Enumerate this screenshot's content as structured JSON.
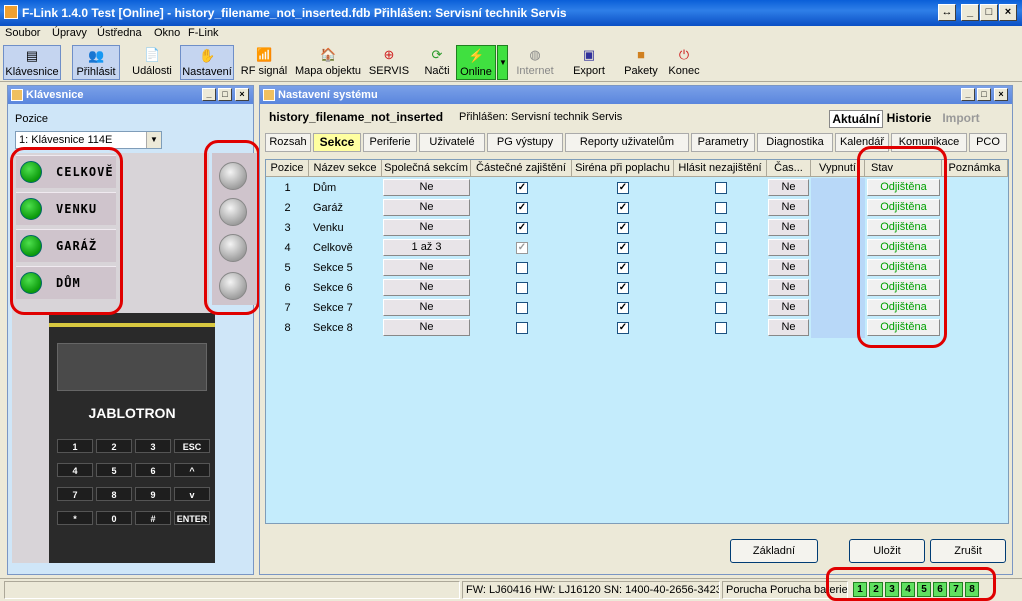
{
  "window": {
    "title": "F-Link 1.4.0 Test [Online] - history_filename_not_inserted.fdb Přihlášen: Servisní technik Servis"
  },
  "menu": [
    "Soubor",
    "Úpravy",
    "Ústředna",
    "Okno",
    "F-Link"
  ],
  "toolbar": [
    {
      "label": "Klávesnice",
      "icon": "keypad-icon"
    },
    {
      "label": "Přihlásit",
      "icon": "users-icon"
    },
    {
      "label": "Události",
      "icon": "document-icon"
    },
    {
      "label": "Nastavení",
      "icon": "hand-icon"
    },
    {
      "label": "RF signál",
      "icon": "antenna-icon"
    },
    {
      "label": "Mapa objektu",
      "icon": "house-icon"
    },
    {
      "label": "SERVIS",
      "icon": "servis-icon"
    },
    {
      "label": "Načti",
      "icon": "refresh-icon"
    },
    {
      "label": "Online",
      "icon": "online-icon"
    },
    {
      "label": "Internet",
      "icon": "globe-icon"
    },
    {
      "label": "Export",
      "icon": "floppy-icon"
    },
    {
      "label": "Pakety",
      "icon": "box-icon"
    },
    {
      "label": "Konec",
      "icon": "exit-icon"
    }
  ],
  "keypad_window": {
    "title": "Klávesnice",
    "position_label": "Pozice",
    "position_value": "1: Klávesnice 114E",
    "zones": [
      "CELKOVĚ",
      "VENKU",
      "GARÁŽ",
      "DŮM"
    ],
    "brand": "JABLOTRON",
    "keys": [
      "1",
      "2",
      "3",
      "ESC",
      "4",
      "5",
      "6",
      "^",
      "7",
      "8",
      "9",
      "v",
      "*",
      "0",
      "#",
      "ENTER"
    ]
  },
  "settings_window": {
    "title": "Nastavení systému",
    "db_name": "history_filename_not_inserted",
    "logged_in": "Přihlášen: Servisní technik Servis",
    "view_current": "Aktuální",
    "view_history": "Historie",
    "view_import": "Import",
    "tabs": [
      "Rozsah",
      "Sekce",
      "Periferie",
      "Uživatelé",
      "PG výstupy",
      "Reporty uživatelům",
      "Parametry",
      "Diagnostika",
      "Kalendář",
      "Komunikace",
      "PCO"
    ],
    "selected_tab": "Sekce",
    "columns": [
      "Pozice",
      "Název sekce",
      "Společná sekcím",
      "Částečné zajištění",
      "Siréna při poplachu",
      "Hlásit nezajištění",
      "Čas...",
      "Vypnutí",
      "Stav",
      "Poznámka"
    ],
    "rows": [
      {
        "pos": "1",
        "name": "Dům",
        "common": "Ne",
        "partial": true,
        "siren": true,
        "report": false,
        "time": "Ne",
        "state": "Odjištěna",
        "partial_disabled": false
      },
      {
        "pos": "2",
        "name": "Garáž",
        "common": "Ne",
        "partial": true,
        "siren": true,
        "report": false,
        "time": "Ne",
        "state": "Odjištěna",
        "partial_disabled": false
      },
      {
        "pos": "3",
        "name": "Venku",
        "common": "Ne",
        "partial": true,
        "siren": true,
        "report": false,
        "time": "Ne",
        "state": "Odjištěna",
        "partial_disabled": false
      },
      {
        "pos": "4",
        "name": "Celkově",
        "common": "1 až 3",
        "partial": true,
        "siren": true,
        "report": false,
        "time": "Ne",
        "state": "Odjištěna",
        "partial_disabled": true
      },
      {
        "pos": "5",
        "name": "Sekce 5",
        "common": "Ne",
        "partial": false,
        "siren": true,
        "report": false,
        "time": "Ne",
        "state": "Odjištěna",
        "partial_disabled": false
      },
      {
        "pos": "6",
        "name": "Sekce 6",
        "common": "Ne",
        "partial": false,
        "siren": true,
        "report": false,
        "time": "Ne",
        "state": "Odjištěna",
        "partial_disabled": false
      },
      {
        "pos": "7",
        "name": "Sekce 7",
        "common": "Ne",
        "partial": false,
        "siren": true,
        "report": false,
        "time": "Ne",
        "state": "Odjištěna",
        "partial_disabled": false
      },
      {
        "pos": "8",
        "name": "Sekce 8",
        "common": "Ne",
        "partial": false,
        "siren": true,
        "report": false,
        "time": "Ne",
        "state": "Odjištěna",
        "partial_disabled": false
      }
    ],
    "btn_basic": "Základní",
    "btn_save": "Uložit",
    "btn_cancel": "Zrušit"
  },
  "status": {
    "firmware": "FW: LJ60416 HW: LJ16120 SN: 1400-40-2656-3423",
    "fault": "Porucha Porucha baterie",
    "segments": [
      "1",
      "2",
      "3",
      "4",
      "5",
      "6",
      "7",
      "8"
    ]
  },
  "colors": {
    "online_green": "#40e040",
    "state_green": "#00a000",
    "grid_bg": "#c4ecfc",
    "highlight": "#e00000"
  }
}
